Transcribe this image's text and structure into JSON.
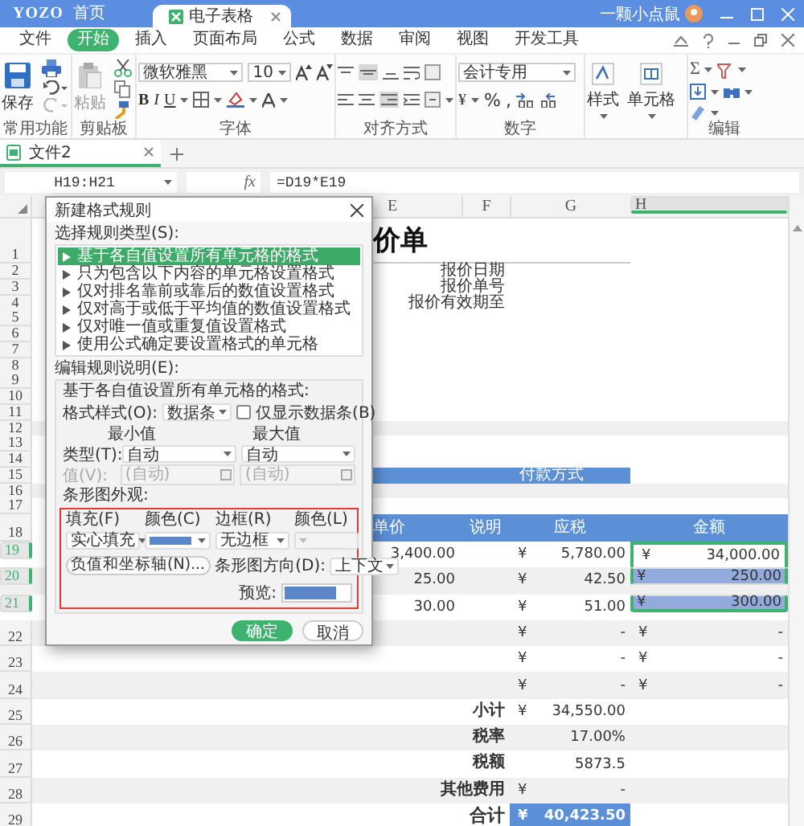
{
  "title_bar": {
    "logo": "YOZO",
    "home": "首页",
    "tab": {
      "label": "电子表格",
      "selected": true
    },
    "user": "一颗小点鼠"
  },
  "menu": [
    {
      "label": "文件",
      "selected": false
    },
    {
      "label": "开始",
      "selected": true
    },
    {
      "label": "插入",
      "selected": false
    },
    {
      "label": "页面布局",
      "selected": false
    },
    {
      "label": "公式",
      "selected": false
    },
    {
      "label": "数据",
      "selected": false
    },
    {
      "label": "审阅",
      "selected": false
    },
    {
      "label": "视图",
      "selected": false
    },
    {
      "label": "开发工具",
      "selected": false
    }
  ],
  "ribbon": {
    "save": "保存",
    "paste": "粘贴",
    "font": "微软雅黑",
    "size": "10",
    "bold": "B",
    "italic": "I",
    "underline": "U",
    "number_format": "会计专用",
    "currency": "¥",
    "percent": "%",
    "comma": ",",
    "styles": "样式",
    "cells": "单元格",
    "sum": "Σ",
    "groups": [
      "常用功能",
      "剪贴板",
      "字体",
      "对齐方式",
      "数字",
      "编辑"
    ]
  },
  "doc_tabs": [
    {
      "label": "文件2",
      "selected": true
    }
  ],
  "formula_bar": {
    "name_box": "H19:H21",
    "fx": "fx",
    "formula": "=D19*E19"
  },
  "sheet": {
    "columns": [
      {
        "label": "E",
        "selected": false
      },
      {
        "label": "F",
        "selected": false
      },
      {
        "label": "G",
        "selected": false
      },
      {
        "label": "H",
        "selected": true
      }
    ],
    "rows": [
      {
        "n": "1",
        "kind": "title",
        "text": "价单",
        "selected": false,
        "shaded": false
      },
      {
        "n": "2",
        "kind": "info",
        "text": "报价日期",
        "selected": false,
        "shaded": false
      },
      {
        "n": "3",
        "kind": "info",
        "text": "报价单号",
        "selected": false,
        "shaded": false
      },
      {
        "n": "4",
        "kind": "info",
        "text": "报价有效期至",
        "selected": false,
        "shaded": false
      },
      {
        "n": "5",
        "kind": "blank",
        "selected": false,
        "shaded": false
      },
      {
        "n": "6",
        "kind": "blank",
        "selected": false,
        "shaded": false
      },
      {
        "n": "7",
        "kind": "blank",
        "selected": false,
        "shaded": false
      },
      {
        "n": "8",
        "kind": "blank",
        "selected": false,
        "shaded": false
      },
      {
        "n": "9",
        "kind": "blank",
        "selected": false,
        "shaded": false
      },
      {
        "n": "10",
        "kind": "blank",
        "selected": false,
        "shaded": false
      },
      {
        "n": "11",
        "kind": "blank",
        "selected": false,
        "shaded": false
      },
      {
        "n": "12",
        "kind": "blank",
        "selected": false,
        "shaded": true
      },
      {
        "n": "13",
        "kind": "blank",
        "selected": false,
        "shaded": false
      },
      {
        "n": "14",
        "kind": "blank",
        "selected": false,
        "shaded": false
      },
      {
        "n": "15",
        "kind": "band",
        "band_text": "付款方式",
        "selected": false,
        "shaded": false
      },
      {
        "n": "16",
        "kind": "blank",
        "selected": false,
        "shaded": true
      },
      {
        "n": "17",
        "kind": "blank",
        "selected": false,
        "shaded": false
      },
      {
        "n": "18",
        "kind": "header",
        "cells": [
          "单价",
          "说明",
          "应税",
          "金额"
        ],
        "selected": false,
        "shaded": false
      },
      {
        "n": "19",
        "kind": "item",
        "selected": true,
        "active": true,
        "shaded": false,
        "price": "3,400.00",
        "tax": [
          "¥",
          "5,780.00"
        ],
        "amount": [
          "¥",
          "34,000.00"
        ]
      },
      {
        "n": "20",
        "kind": "item",
        "selected": true,
        "active": false,
        "shaded": true,
        "price": "25.00",
        "tax": [
          "¥",
          "42.50"
        ],
        "amount": [
          "¥",
          "250.00"
        ]
      },
      {
        "n": "21",
        "kind": "item",
        "selected": true,
        "active": false,
        "shaded": false,
        "price": "30.00",
        "tax": [
          "¥",
          "51.00"
        ],
        "amount": [
          "¥",
          "300.00"
        ]
      },
      {
        "n": "22",
        "kind": "item",
        "selected": false,
        "active": false,
        "shaded": true,
        "tax": [
          "¥",
          "-"
        ],
        "amount": [
          "¥",
          "-"
        ]
      },
      {
        "n": "23",
        "kind": "item",
        "selected": false,
        "active": false,
        "shaded": false,
        "tax": [
          "¥",
          "-"
        ],
        "amount": [
          "¥",
          "-"
        ]
      },
      {
        "n": "24",
        "kind": "item",
        "selected": false,
        "active": false,
        "shaded": true,
        "tax": [
          "¥",
          "-"
        ],
        "amount": [
          "¥",
          "-"
        ]
      },
      {
        "n": "25",
        "kind": "summary",
        "label": "小计",
        "symbol": "¥",
        "value": "34,550.00",
        "selected": false,
        "shaded": false
      },
      {
        "n": "26",
        "kind": "summary",
        "label": "税率",
        "value": "17.00%",
        "selected": false,
        "shaded": true
      },
      {
        "n": "27",
        "kind": "summary",
        "label": "税额",
        "value": "5873.5",
        "selected": false,
        "shaded": false
      },
      {
        "n": "28",
        "kind": "summary",
        "label": "其他费用",
        "symbol": "¥",
        "value": "-",
        "selected": false,
        "shaded": true
      },
      {
        "n": "29",
        "kind": "total",
        "label": "合计",
        "symbol": "¥",
        "value": "40,423.50",
        "selected": false,
        "shaded": false
      }
    ]
  },
  "dialog": {
    "title": "新建格式规则",
    "rule_type_label": "选择规则类型(S):",
    "rule_types": [
      {
        "label": "基于各自值设置所有单元格的格式",
        "selected": true
      },
      {
        "label": "只为包含以下内容的单元格设置格式",
        "selected": false
      },
      {
        "label": "仅对排名靠前或靠后的数值设置格式",
        "selected": false
      },
      {
        "label": "仅对高于或低于平均值的数值设置格式",
        "selected": false
      },
      {
        "label": "仅对唯一值或重复值设置格式",
        "selected": false
      },
      {
        "label": "使用公式确定要设置格式的单元格",
        "selected": false
      }
    ],
    "edit_label": "编辑规则说明(E):",
    "description": "基于各自值设置所有单元格的格式:",
    "style_label": "格式样式(O):",
    "style_value": "数据条",
    "bar_only": {
      "label": "仅显示数据条(B)",
      "checked": false
    },
    "min_label": "最小值",
    "max_label": "最大值",
    "type_label": "类型(T):",
    "min_type": "自动",
    "max_type": "自动",
    "value_label": "值(V):",
    "min_value": {
      "placeholder": "(自动)",
      "disabled": true
    },
    "max_value": {
      "placeholder": "(自动)",
      "disabled": true
    },
    "appearance_label": "条形图外观:",
    "fill_label": "填充(F)",
    "fill_value": "实心填充",
    "color_label": "颜色(C)",
    "border_label": "边框(R)",
    "border_value": "无边框",
    "border_color_label": "颜色(L)",
    "border_color_disabled": true,
    "axis_button": "负值和坐标轴(N)...",
    "direction_label": "条形图方向(D):",
    "direction_value": "上下文",
    "preview_label": "预览:",
    "ok": "确定",
    "cancel": "取消"
  }
}
